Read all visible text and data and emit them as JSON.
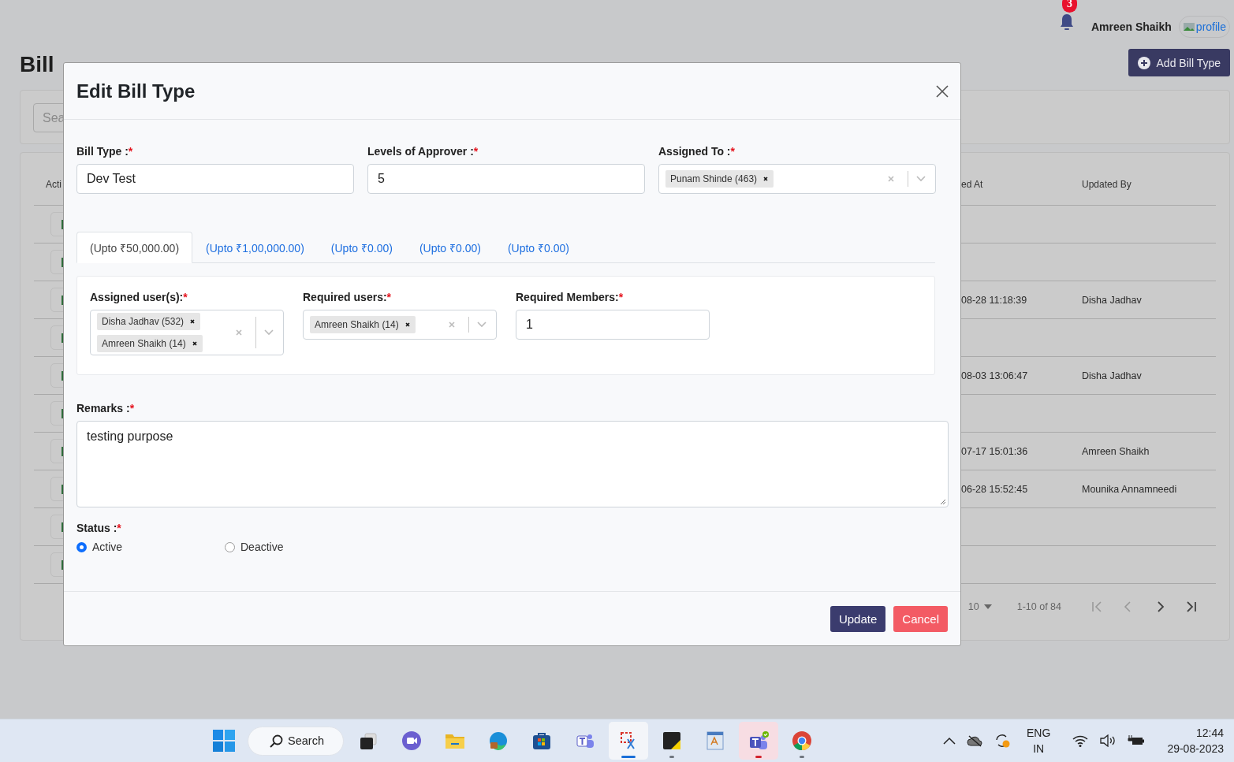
{
  "header": {
    "notification_count": "3",
    "user_name": "Amreen Shaikh",
    "avatar_alt": "profile"
  },
  "page": {
    "title": "Bill",
    "add_button": "Add Bill Type",
    "search_placeholder": "Sea"
  },
  "table": {
    "columns": [
      "Acti",
      "ed At",
      "Updated By"
    ],
    "rows": [
      {},
      {},
      {
        "column_2": "08-28 11:18:39",
        "column_3": "Disha Jadhav"
      },
      {},
      {
        "column_2": "08-03 13:06:47",
        "column_3": "Disha Jadhav"
      },
      {},
      {
        "column_2": "07-17 15:01:36",
        "column_3": "Amreen Shaikh"
      },
      {
        "column_2": "06-28 15:52:45",
        "column_3": "Mounika Annamneedi"
      },
      {},
      {}
    ]
  },
  "pagination": {
    "page_size": "10",
    "range": "1-10 of 84"
  },
  "modal": {
    "title": "Edit Bill Type",
    "fields": [
      {
        "kind": "text",
        "label": "Bill Type :",
        "required_mark": "*",
        "value": "Dev Test"
      },
      {
        "kind": "text",
        "label": "Levels of Approver :",
        "required_mark": "*",
        "value": "5"
      },
      {
        "kind": "multiselect",
        "label": "Assigned To :",
        "required_mark": "*",
        "chips": [
          "Punam Shinde (463)"
        ]
      }
    ],
    "tabs": [
      {
        "label": "(Upto ₹50,000.00)",
        "selected": true
      },
      {
        "label": "(Upto ₹1,00,000.00)",
        "selected": false
      },
      {
        "label": "(Upto ₹0.00)",
        "selected": false
      },
      {
        "label": "(Upto ₹0.00)",
        "selected": false
      },
      {
        "label": "(Upto ₹0.00)",
        "selected": false
      }
    ],
    "level_fields": [
      {
        "kind": "multiselect",
        "label": "Assigned user(s):",
        "required_mark": "*",
        "chips": [
          "Disha Jadhav (532)",
          "Amreen Shaikh (14)"
        ]
      },
      {
        "kind": "multiselect",
        "label": "Required users:",
        "required_mark": "*",
        "chips": [
          "Amreen Shaikh (14)"
        ]
      },
      {
        "kind": "text",
        "label": "Required Members:",
        "required_mark": "*",
        "value": "1"
      }
    ],
    "remarks": {
      "label": "Remarks :",
      "required_mark": "*",
      "value": "testing purpose"
    },
    "status": {
      "label": "Status :",
      "required_mark": "*",
      "options": [
        {
          "label": "Active",
          "selected": true
        },
        {
          "label": "Deactive",
          "selected": false
        }
      ]
    },
    "buttons": [
      {
        "kind": "primary",
        "label": "Update"
      },
      {
        "kind": "danger",
        "label": "Cancel"
      }
    ]
  },
  "taskbar": {
    "search_label": "Search",
    "apps": [
      {
        "kind": "task-view",
        "running": false,
        "selected": false,
        "attention": false
      },
      {
        "kind": "meet",
        "running": false,
        "selected": false,
        "attention": false
      },
      {
        "kind": "folder",
        "running": false,
        "selected": false,
        "attention": false
      },
      {
        "kind": "edge",
        "running": false,
        "selected": false,
        "attention": false
      },
      {
        "kind": "store",
        "running": false,
        "selected": false,
        "attention": false
      },
      {
        "kind": "teams",
        "running": false,
        "selected": false,
        "attention": false
      },
      {
        "kind": "snipping",
        "running": true,
        "selected": true,
        "attention": false
      },
      {
        "kind": "sticky",
        "running": true,
        "selected": false,
        "attention": false
      },
      {
        "kind": "wordpad",
        "running": false,
        "selected": false,
        "attention": false
      },
      {
        "kind": "teams-work",
        "running": true,
        "selected": false,
        "attention": true
      },
      {
        "kind": "chrome",
        "running": true,
        "selected": false,
        "attention": false
      }
    ],
    "language": "ENG",
    "region": "IN",
    "time": "12:44",
    "date": "29-08-2023"
  }
}
